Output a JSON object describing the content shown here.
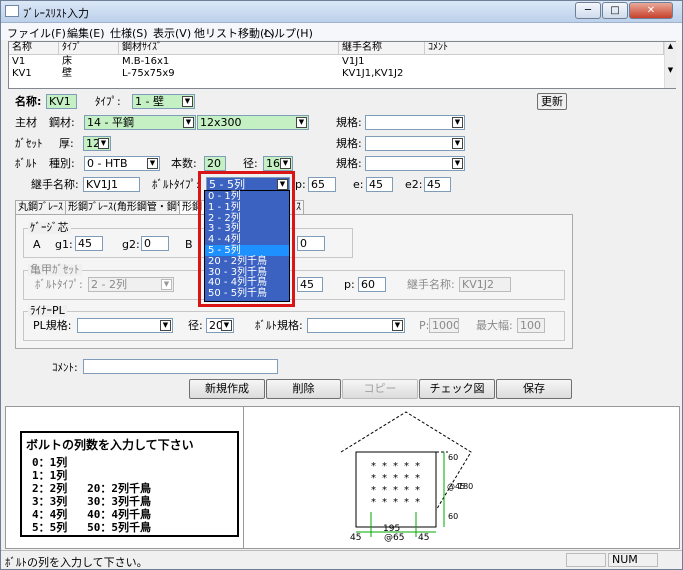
{
  "window": {
    "title": "ﾌﾞﾚｰｽﾘｽﾄ入力",
    "min": "─",
    "max": "□",
    "close": "✕"
  },
  "menu": [
    "ファイル(F)",
    "編集(E)",
    "仕様(S)",
    "表示(V)",
    "他リスト移動(L)",
    "ヘルプ(H)"
  ],
  "list": {
    "headers": [
      "名称",
      "ﾀｲﾌﾟ",
      "鋼材ｻｲｽﾞ",
      "継手名称",
      "ｺﾒﾝﾄ"
    ],
    "rows": [
      [
        "V1",
        "床",
        "M.B-16x1",
        "V1J1",
        ""
      ],
      [
        "KV1",
        "壁",
        "L-75x75x9",
        "KV1J1,KV1J2",
        ""
      ],
      [
        "",
        "",
        "",
        "",
        ""
      ]
    ]
  },
  "form": {
    "name_label": "名称:",
    "name_value": "KV1",
    "type_label": "ﾀｲﾌﾟ:",
    "type_value": "1 - 壁",
    "update_button": "更新",
    "main_label": "主材",
    "steel_label": "鋼材:",
    "steel_value": "14 - 平鋼",
    "steel_size": "12x300",
    "spec_label": "規格:",
    "gusset_label": "ｶﾞｾｯﾄ",
    "thick_label": "厚:",
    "thick_value": "12",
    "bolt_label": "ﾎﾞﾙﾄ",
    "kind_label": "種別:",
    "kind_value": "0 - HTB",
    "count_label": "本数:",
    "count_value": "20",
    "dia_label": "径:",
    "dia_value": "16",
    "joint_label": "継手名称:",
    "joint_value": "KV1J1",
    "bolt_type_label": "ﾎﾞﾙﾄﾀｲﾌﾟ:",
    "bolt_type_value": "5 - 5列",
    "p_label": "p:",
    "p_value": "65",
    "e_label": "e:",
    "e_value": "45",
    "e2_label": "e2:",
    "e2_value": "45"
  },
  "tabs": [
    "丸鋼ﾌﾞﾚｰｽ",
    "形鋼ﾌﾞﾚｰｽ(角形鋼管・鋼管)",
    "形鋼",
    "ｽ"
  ],
  "gauge": {
    "label": "ｹﾞｰｼﾞ芯",
    "a_label": "A",
    "g1_label": "g1:",
    "g1_value": "45",
    "g2_label": "g2:",
    "g2_value": "0",
    "b_label": "B",
    "right_value": "0"
  },
  "kikko": {
    "label": "亀甲ｶﾞｾｯﾄ",
    "bolt_type_label": "ﾎﾞﾙﾄﾀｲﾌﾟ:",
    "bolt_type_value": "2 - 2列",
    "v1": "45",
    "p_label": "p:",
    "p_value": "60",
    "joint_label": "継手名称:",
    "joint_value": "KV1J2"
  },
  "liner": {
    "label": "ﾗｲﾅｰPL",
    "spec_label": "PL規格:",
    "dia_label": "径:",
    "dia_value": "20",
    "bolt_spec_label": "ﾎﾞﾙﾄ規格:",
    "p_label": "P:",
    "p_value": "1000",
    "max_label": "最大幅:",
    "max_value": "100"
  },
  "comment_label": "ｺﾒﾝﾄ:",
  "buttons": {
    "new": "新規作成",
    "delete": "削除",
    "copy": "コピー",
    "check": "チェック図",
    "save": "保存"
  },
  "dropdown_options": [
    "0 - 1列",
    "1 - 1列",
    "2 - 2列",
    "3 - 3列",
    "4 - 4列",
    "5 - 5列",
    "20 - 2列千鳥",
    "30 - 3列千鳥",
    "40 - 4列千鳥",
    "50 - 5列千鳥"
  ],
  "dropdown_selected_index": 5,
  "help": {
    "title": "ボルトの列数を入力して下さい",
    "lines": [
      "0：1列",
      "1：1列",
      "2：2列   20：2列千鳥",
      "3：3列   30：3列千鳥",
      "4：4列   40：4列千鳥",
      "5：5列   50：5列千鳥"
    ]
  },
  "drawing": {
    "dims": [
      "195",
      "@65",
      "45",
      "45",
      "60",
      "@45",
      "180",
      "60"
    ]
  },
  "status": {
    "text": "ﾎﾞﾙﾄの列を入力して下さい。",
    "num": "NUM"
  }
}
